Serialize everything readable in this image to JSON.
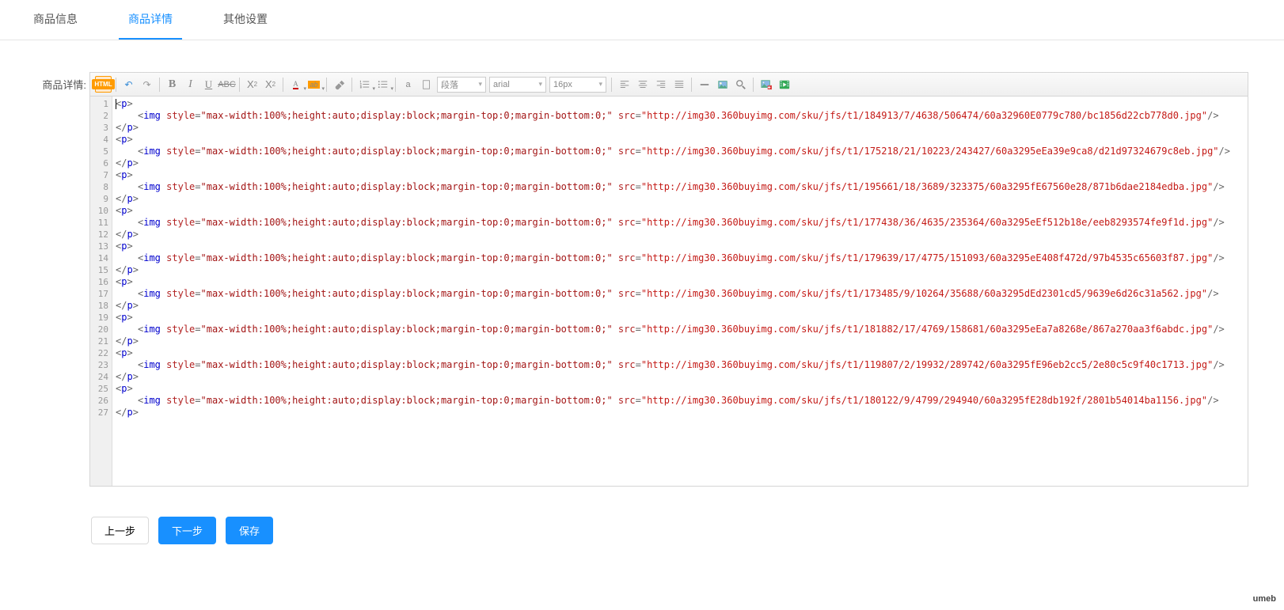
{
  "tabs": [
    "商品信息",
    "商品详情",
    "其他设置"
  ],
  "activeTab": 1,
  "label": "商品详情:",
  "toolbar": {
    "htmlBadge": "HTML",
    "formatSelect": "段落",
    "fontFamily": "arial",
    "fontSize": "16px"
  },
  "codeLines": [
    {
      "tokens": [
        {
          "t": "cursor"
        },
        {
          "t": "punc",
          "v": "<"
        },
        {
          "t": "tag",
          "v": "p"
        },
        {
          "t": "punc",
          "v": ">"
        }
      ]
    },
    {
      "indent": 4,
      "tokens": [
        {
          "t": "punc",
          "v": "<"
        },
        {
          "t": "tag",
          "v": "img"
        },
        {
          "t": "space"
        },
        {
          "t": "attr",
          "v": "style"
        },
        {
          "t": "eq",
          "v": "="
        },
        {
          "t": "str",
          "v": "\"max-width:100%;height:auto;display:block;margin-top:0;margin-bottom:0;\""
        },
        {
          "t": "space"
        },
        {
          "t": "attr",
          "v": "src"
        },
        {
          "t": "eq",
          "v": "="
        },
        {
          "t": "url",
          "v": "\"http://img30.360buyimg.com/sku/jfs/t1/184913/7/4638/506474/60a32960E0779c780/bc1856d22cb778d0.jpg\""
        },
        {
          "t": "punc",
          "v": "/>"
        }
      ]
    },
    {
      "tokens": [
        {
          "t": "punc",
          "v": "</"
        },
        {
          "t": "tag",
          "v": "p"
        },
        {
          "t": "punc",
          "v": ">"
        }
      ]
    },
    {
      "tokens": [
        {
          "t": "punc",
          "v": "<"
        },
        {
          "t": "tag",
          "v": "p"
        },
        {
          "t": "punc",
          "v": ">"
        }
      ]
    },
    {
      "indent": 4,
      "tokens": [
        {
          "t": "punc",
          "v": "<"
        },
        {
          "t": "tag",
          "v": "img"
        },
        {
          "t": "space"
        },
        {
          "t": "attr",
          "v": "style"
        },
        {
          "t": "eq",
          "v": "="
        },
        {
          "t": "str",
          "v": "\"max-width:100%;height:auto;display:block;margin-top:0;margin-bottom:0;\""
        },
        {
          "t": "space"
        },
        {
          "t": "attr",
          "v": "src"
        },
        {
          "t": "eq",
          "v": "="
        },
        {
          "t": "url",
          "v": "\"http://img30.360buyimg.com/sku/jfs/t1/175218/21/10223/243427/60a3295eEa39e9ca8/d21d97324679c8eb.jpg\""
        },
        {
          "t": "punc",
          "v": "/>"
        }
      ]
    },
    {
      "tokens": [
        {
          "t": "punc",
          "v": "</"
        },
        {
          "t": "tag",
          "v": "p"
        },
        {
          "t": "punc",
          "v": ">"
        }
      ]
    },
    {
      "tokens": [
        {
          "t": "punc",
          "v": "<"
        },
        {
          "t": "tag",
          "v": "p"
        },
        {
          "t": "punc",
          "v": ">"
        }
      ]
    },
    {
      "indent": 4,
      "tokens": [
        {
          "t": "punc",
          "v": "<"
        },
        {
          "t": "tag",
          "v": "img"
        },
        {
          "t": "space"
        },
        {
          "t": "attr",
          "v": "style"
        },
        {
          "t": "eq",
          "v": "="
        },
        {
          "t": "str",
          "v": "\"max-width:100%;height:auto;display:block;margin-top:0;margin-bottom:0;\""
        },
        {
          "t": "space"
        },
        {
          "t": "attr",
          "v": "src"
        },
        {
          "t": "eq",
          "v": "="
        },
        {
          "t": "url",
          "v": "\"http://img30.360buyimg.com/sku/jfs/t1/195661/18/3689/323375/60a3295fE67560e28/871b6dae2184edba.jpg\""
        },
        {
          "t": "punc",
          "v": "/>"
        }
      ]
    },
    {
      "tokens": [
        {
          "t": "punc",
          "v": "</"
        },
        {
          "t": "tag",
          "v": "p"
        },
        {
          "t": "punc",
          "v": ">"
        }
      ]
    },
    {
      "tokens": [
        {
          "t": "punc",
          "v": "<"
        },
        {
          "t": "tag",
          "v": "p"
        },
        {
          "t": "punc",
          "v": ">"
        }
      ]
    },
    {
      "indent": 4,
      "tokens": [
        {
          "t": "punc",
          "v": "<"
        },
        {
          "t": "tag",
          "v": "img"
        },
        {
          "t": "space"
        },
        {
          "t": "attr",
          "v": "style"
        },
        {
          "t": "eq",
          "v": "="
        },
        {
          "t": "str",
          "v": "\"max-width:100%;height:auto;display:block;margin-top:0;margin-bottom:0;\""
        },
        {
          "t": "space"
        },
        {
          "t": "attr",
          "v": "src"
        },
        {
          "t": "eq",
          "v": "="
        },
        {
          "t": "url",
          "v": "\"http://img30.360buyimg.com/sku/jfs/t1/177438/36/4635/235364/60a3295eEf512b18e/eeb8293574fe9f1d.jpg\""
        },
        {
          "t": "punc",
          "v": "/>"
        }
      ]
    },
    {
      "tokens": [
        {
          "t": "punc",
          "v": "</"
        },
        {
          "t": "tag",
          "v": "p"
        },
        {
          "t": "punc",
          "v": ">"
        }
      ]
    },
    {
      "tokens": [
        {
          "t": "punc",
          "v": "<"
        },
        {
          "t": "tag",
          "v": "p"
        },
        {
          "t": "punc",
          "v": ">"
        }
      ]
    },
    {
      "indent": 4,
      "tokens": [
        {
          "t": "punc",
          "v": "<"
        },
        {
          "t": "tag",
          "v": "img"
        },
        {
          "t": "space"
        },
        {
          "t": "attr",
          "v": "style"
        },
        {
          "t": "eq",
          "v": "="
        },
        {
          "t": "str",
          "v": "\"max-width:100%;height:auto;display:block;margin-top:0;margin-bottom:0;\""
        },
        {
          "t": "space"
        },
        {
          "t": "attr",
          "v": "src"
        },
        {
          "t": "eq",
          "v": "="
        },
        {
          "t": "url",
          "v": "\"http://img30.360buyimg.com/sku/jfs/t1/179639/17/4775/151093/60a3295eE408f472d/97b4535c65603f87.jpg\""
        },
        {
          "t": "punc",
          "v": "/>"
        }
      ]
    },
    {
      "tokens": [
        {
          "t": "punc",
          "v": "</"
        },
        {
          "t": "tag",
          "v": "p"
        },
        {
          "t": "punc",
          "v": ">"
        }
      ]
    },
    {
      "tokens": [
        {
          "t": "punc",
          "v": "<"
        },
        {
          "t": "tag",
          "v": "p"
        },
        {
          "t": "punc",
          "v": ">"
        }
      ]
    },
    {
      "indent": 4,
      "tokens": [
        {
          "t": "punc",
          "v": "<"
        },
        {
          "t": "tag",
          "v": "img"
        },
        {
          "t": "space"
        },
        {
          "t": "attr",
          "v": "style"
        },
        {
          "t": "eq",
          "v": "="
        },
        {
          "t": "str",
          "v": "\"max-width:100%;height:auto;display:block;margin-top:0;margin-bottom:0;\""
        },
        {
          "t": "space"
        },
        {
          "t": "attr",
          "v": "src"
        },
        {
          "t": "eq",
          "v": "="
        },
        {
          "t": "url",
          "v": "\"http://img30.360buyimg.com/sku/jfs/t1/173485/9/10264/35688/60a3295dEd2301cd5/9639e6d26c31a562.jpg\""
        },
        {
          "t": "punc",
          "v": "/>"
        }
      ]
    },
    {
      "tokens": [
        {
          "t": "punc",
          "v": "</"
        },
        {
          "t": "tag",
          "v": "p"
        },
        {
          "t": "punc",
          "v": ">"
        }
      ]
    },
    {
      "tokens": [
        {
          "t": "punc",
          "v": "<"
        },
        {
          "t": "tag",
          "v": "p"
        },
        {
          "t": "punc",
          "v": ">"
        }
      ]
    },
    {
      "indent": 4,
      "tokens": [
        {
          "t": "punc",
          "v": "<"
        },
        {
          "t": "tag",
          "v": "img"
        },
        {
          "t": "space"
        },
        {
          "t": "attr",
          "v": "style"
        },
        {
          "t": "eq",
          "v": "="
        },
        {
          "t": "str",
          "v": "\"max-width:100%;height:auto;display:block;margin-top:0;margin-bottom:0;\""
        },
        {
          "t": "space"
        },
        {
          "t": "attr",
          "v": "src"
        },
        {
          "t": "eq",
          "v": "="
        },
        {
          "t": "url",
          "v": "\"http://img30.360buyimg.com/sku/jfs/t1/181882/17/4769/158681/60a3295eEa7a8268e/867a270aa3f6abdc.jpg\""
        },
        {
          "t": "punc",
          "v": "/>"
        }
      ]
    },
    {
      "tokens": [
        {
          "t": "punc",
          "v": "</"
        },
        {
          "t": "tag",
          "v": "p"
        },
        {
          "t": "punc",
          "v": ">"
        }
      ]
    },
    {
      "tokens": [
        {
          "t": "punc",
          "v": "<"
        },
        {
          "t": "tag",
          "v": "p"
        },
        {
          "t": "punc",
          "v": ">"
        }
      ]
    },
    {
      "indent": 4,
      "tokens": [
        {
          "t": "punc",
          "v": "<"
        },
        {
          "t": "tag",
          "v": "img"
        },
        {
          "t": "space"
        },
        {
          "t": "attr",
          "v": "style"
        },
        {
          "t": "eq",
          "v": "="
        },
        {
          "t": "str",
          "v": "\"max-width:100%;height:auto;display:block;margin-top:0;margin-bottom:0;\""
        },
        {
          "t": "space"
        },
        {
          "t": "attr",
          "v": "src"
        },
        {
          "t": "eq",
          "v": "="
        },
        {
          "t": "url",
          "v": "\"http://img30.360buyimg.com/sku/jfs/t1/119807/2/19932/289742/60a3295fE96eb2cc5/2e80c5c9f40c1713.jpg\""
        },
        {
          "t": "punc",
          "v": "/>"
        }
      ]
    },
    {
      "tokens": [
        {
          "t": "punc",
          "v": "</"
        },
        {
          "t": "tag",
          "v": "p"
        },
        {
          "t": "punc",
          "v": ">"
        }
      ]
    },
    {
      "tokens": [
        {
          "t": "punc",
          "v": "<"
        },
        {
          "t": "tag",
          "v": "p"
        },
        {
          "t": "punc",
          "v": ">"
        }
      ]
    },
    {
      "indent": 4,
      "tokens": [
        {
          "t": "punc",
          "v": "<"
        },
        {
          "t": "tag",
          "v": "img"
        },
        {
          "t": "space"
        },
        {
          "t": "attr",
          "v": "style"
        },
        {
          "t": "eq",
          "v": "="
        },
        {
          "t": "str",
          "v": "\"max-width:100%;height:auto;display:block;margin-top:0;margin-bottom:0;\""
        },
        {
          "t": "space"
        },
        {
          "t": "attr",
          "v": "src"
        },
        {
          "t": "eq",
          "v": "="
        },
        {
          "t": "url",
          "v": "\"http://img30.360buyimg.com/sku/jfs/t1/180122/9/4799/294940/60a3295fE28db192f/2801b54014ba1156.jpg\""
        },
        {
          "t": "punc",
          "v": "/>"
        }
      ]
    },
    {
      "tokens": [
        {
          "t": "punc",
          "v": "</"
        },
        {
          "t": "tag",
          "v": "p"
        },
        {
          "t": "punc",
          "v": ">"
        }
      ]
    }
  ],
  "buttons": {
    "prev": "上一步",
    "next": "下一步",
    "save": "保存"
  },
  "logo": "umeb"
}
